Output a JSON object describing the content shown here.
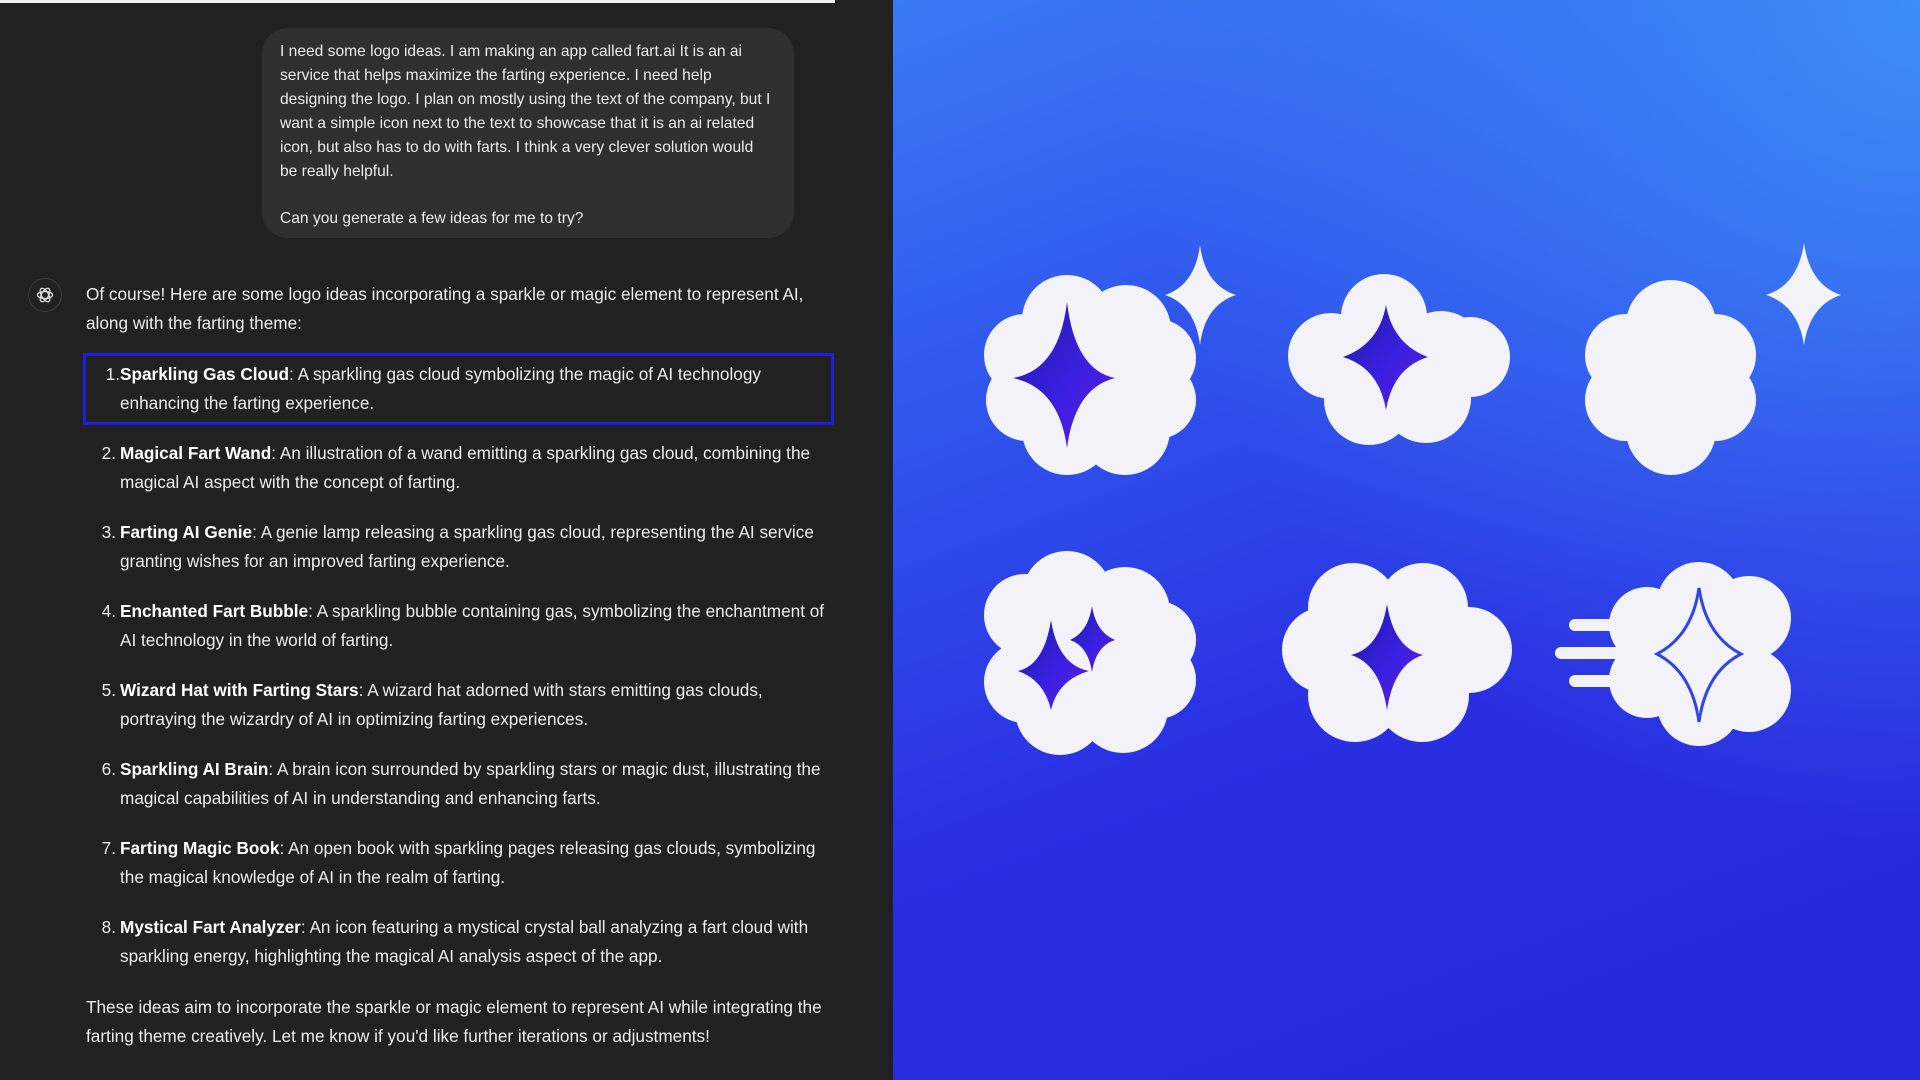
{
  "chat": {
    "user_message": {
      "paragraph1": "I need some logo ideas. I am making an app called fart.ai It is an ai service that helps maximize the farting experience. I need help designing the logo. I plan on mostly using the text of the company, but I want a simple icon next to the text to showcase that it is an ai related icon, but also has to do with farts. I think a very clever solution would be really helpful.",
      "paragraph2": "Can you generate a few ideas for me to try?"
    },
    "assistant": {
      "intro": "Of course! Here are some logo ideas incorporating a sparkle or magic element to represent AI, along with the farting theme:",
      "ideas": [
        {
          "num": "1.",
          "title": "Sparkling Gas Cloud",
          "desc": ": A sparkling gas cloud symbolizing the magic of AI technology enhancing the farting experience."
        },
        {
          "num": "2.",
          "title": "Magical Fart Wand",
          "desc": ": An illustration of a wand emitting a sparkling gas cloud, combining the magical AI aspect with the concept of farting."
        },
        {
          "num": "3.",
          "title": "Farting AI Genie",
          "desc": ": A genie lamp releasing a sparkling gas cloud, representing the AI service granting wishes for an improved farting experience."
        },
        {
          "num": "4.",
          "title": "Enchanted Fart Bubble",
          "desc": ": A sparkling bubble containing gas, symbolizing the enchantment of AI technology in the world of farting."
        },
        {
          "num": "5.",
          "title": "Wizard Hat with Farting Stars",
          "desc": ": A wizard hat adorned with stars emitting gas clouds, portraying the wizardry of AI in optimizing farting experiences."
        },
        {
          "num": "6.",
          "title": "Sparkling AI Brain",
          "desc": ": A brain icon surrounded by sparkling stars or magic dust, illustrating the magical capabilities of AI in understanding and enhancing farts."
        },
        {
          "num": "7.",
          "title": "Farting Magic Book",
          "desc": ": An open book with sparkling pages releasing gas clouds, symbolizing the magical knowledge of AI in the realm of farting."
        },
        {
          "num": "8.",
          "title": "Mystical Fart Analyzer",
          "desc": ": An icon featuring a mystical crystal ball analyzing a fart cloud with sparkling energy, highlighting the magical AI analysis aspect of the app."
        }
      ],
      "outro": "These ideas aim to incorporate the sparkle or magic element to represent AI while integrating the farting theme creatively. Let me know if you'd like further iterations or adjustments!"
    }
  },
  "colors": {
    "chat_background": "#212121",
    "user_bubble": "#2f2f2f",
    "highlight_border": "#1f1ee0",
    "panel_gradient_top": "#3a7af4",
    "panel_gradient_bottom": "#2428d9",
    "cloud_fill": "#f3f2f8",
    "sparkle_gradient": [
      "#1c1aa8",
      "#5a1fd6",
      "#3b1fe0"
    ]
  },
  "logo_concepts": [
    {
      "id": "cloud-sparkle-with-star",
      "icons": [
        "cloud-icon",
        "sparkle-icon",
        "star-icon"
      ]
    },
    {
      "id": "wide-cloud-sparkle",
      "icons": [
        "cloud-icon",
        "sparkle-icon"
      ]
    },
    {
      "id": "plain-cloud-with-star",
      "icons": [
        "cloud-icon",
        "star-icon"
      ]
    },
    {
      "id": "cloud-double-sparkle",
      "icons": [
        "cloud-icon",
        "sparkle-icon",
        "sparkle-icon"
      ]
    },
    {
      "id": "double-cloud-sparkle",
      "icons": [
        "cloud-icon",
        "sparkle-icon"
      ]
    },
    {
      "id": "speed-cloud-sparkle",
      "icons": [
        "speed-lines-icon",
        "cloud-icon",
        "sparkle-icon"
      ]
    }
  ]
}
